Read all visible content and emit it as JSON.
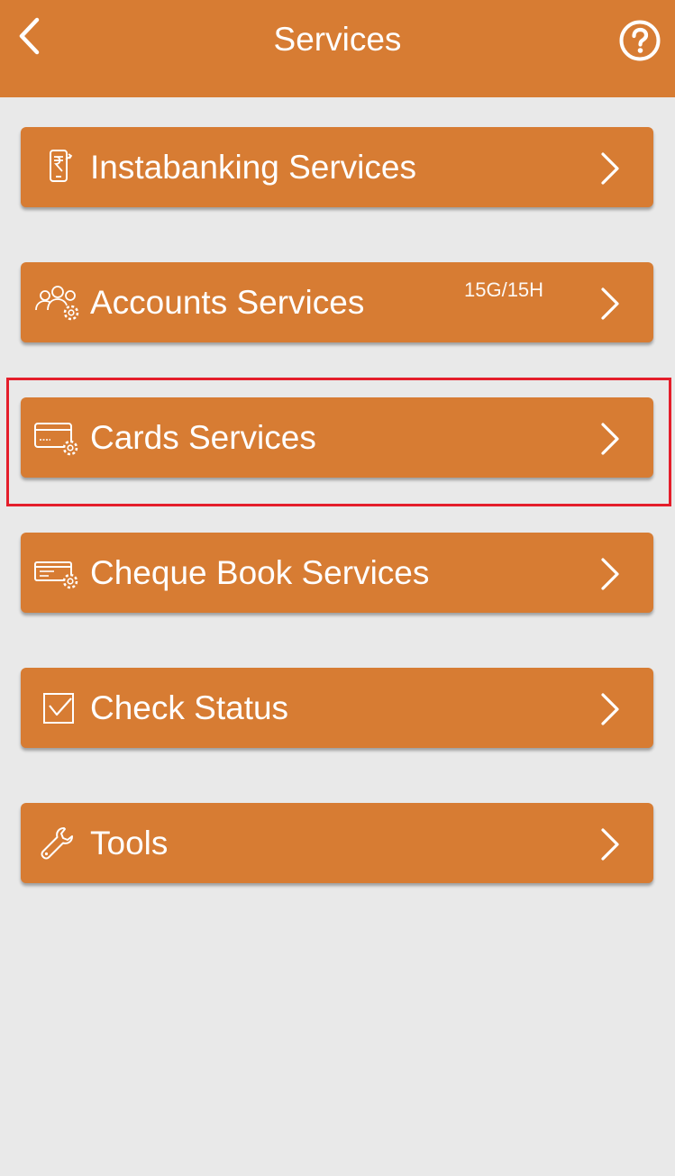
{
  "header": {
    "title": "Services",
    "back_icon": "chevron-left-icon",
    "help_icon": "question-circle-icon"
  },
  "menu": {
    "items": [
      {
        "label": "Instabanking Services",
        "badge": "",
        "icon": "mobile-rupee-icon"
      },
      {
        "label": "Accounts Services",
        "badge": "15G/15H",
        "icon": "users-gear-icon"
      },
      {
        "label": "Cards Services",
        "badge": "",
        "icon": "card-gear-icon",
        "highlighted": true
      },
      {
        "label": "Cheque Book Services",
        "badge": "",
        "icon": "cheque-gear-icon"
      },
      {
        "label": "Check Status",
        "badge": "",
        "icon": "check-box-icon"
      },
      {
        "label": "Tools",
        "badge": "",
        "icon": "wrench-icon"
      }
    ]
  },
  "colors": {
    "brand_orange": "#d77c33",
    "background": "#e9e9e9",
    "highlight_red": "#e41e2b",
    "text": "#ffffff"
  }
}
